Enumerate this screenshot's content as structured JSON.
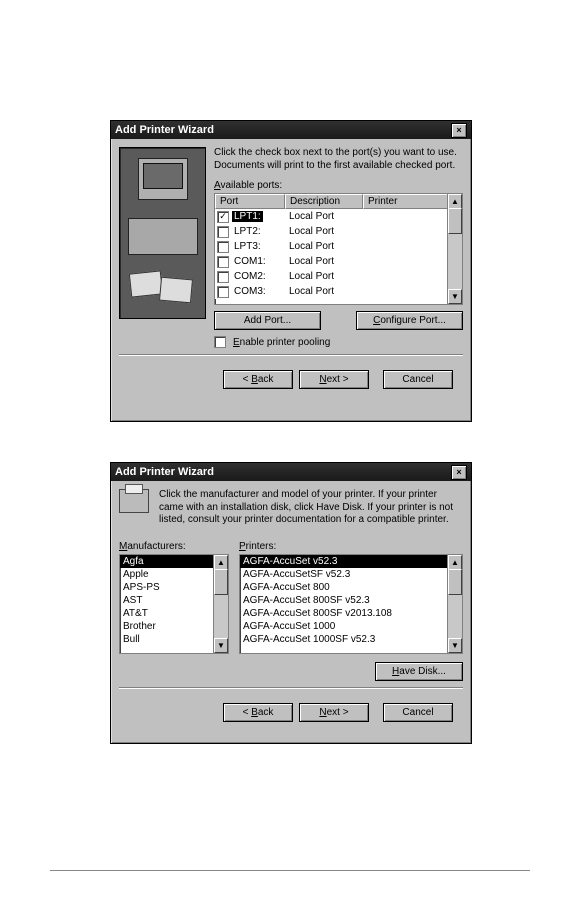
{
  "dialog1": {
    "title": "Add Printer Wizard",
    "instruction": "Click the check box next to the port(s) you want to use. Documents will print to the first available checked port.",
    "ports_label": "Available ports:",
    "ports_header": {
      "port": "Port",
      "desc": "Description",
      "printer": "Printer"
    },
    "ports": [
      {
        "checked": true,
        "name": "LPT1:",
        "desc": "Local Port",
        "printer": "",
        "selected": true
      },
      {
        "checked": false,
        "name": "LPT2:",
        "desc": "Local Port",
        "printer": ""
      },
      {
        "checked": false,
        "name": "LPT3:",
        "desc": "Local Port",
        "printer": ""
      },
      {
        "checked": false,
        "name": "COM1:",
        "desc": "Local Port",
        "printer": ""
      },
      {
        "checked": false,
        "name": "COM2:",
        "desc": "Local Port",
        "printer": ""
      },
      {
        "checked": false,
        "name": "COM3:",
        "desc": "Local Port",
        "printer": ""
      }
    ],
    "add_port_btn": "Add Port...",
    "configure_port_btn": "Configure Port...",
    "enable_pooling": "Enable printer pooling",
    "back_btn": "< Back",
    "next_btn": "Next >",
    "cancel_btn": "Cancel"
  },
  "dialog2": {
    "title": "Add Printer Wizard",
    "instruction": "Click the manufacturer and model of your printer.  If your printer came with an installation disk, click Have Disk.  If your printer is not listed, consult your printer documentation for a compatible printer.",
    "manufacturers_label": "Manufacturers:",
    "printers_label": "Printers:",
    "manufacturers": [
      {
        "name": "Agfa",
        "selected": true
      },
      {
        "name": "Apple"
      },
      {
        "name": "APS-PS"
      },
      {
        "name": "AST"
      },
      {
        "name": "AT&T"
      },
      {
        "name": "Brother"
      },
      {
        "name": "Bull"
      }
    ],
    "printers": [
      {
        "name": "AGFA-AccuSet v52.3",
        "selected": true
      },
      {
        "name": "AGFA-AccuSetSF v52.3"
      },
      {
        "name": "AGFA-AccuSet 800"
      },
      {
        "name": "AGFA-AccuSet 800SF v52.3"
      },
      {
        "name": "AGFA-AccuSet 800SF v2013.108"
      },
      {
        "name": "AGFA-AccuSet 1000"
      },
      {
        "name": "AGFA-AccuSet 1000SF v52.3"
      }
    ],
    "have_disk_btn": "Have Disk...",
    "back_btn": "< Back",
    "next_btn": "Next >",
    "cancel_btn": "Cancel"
  }
}
